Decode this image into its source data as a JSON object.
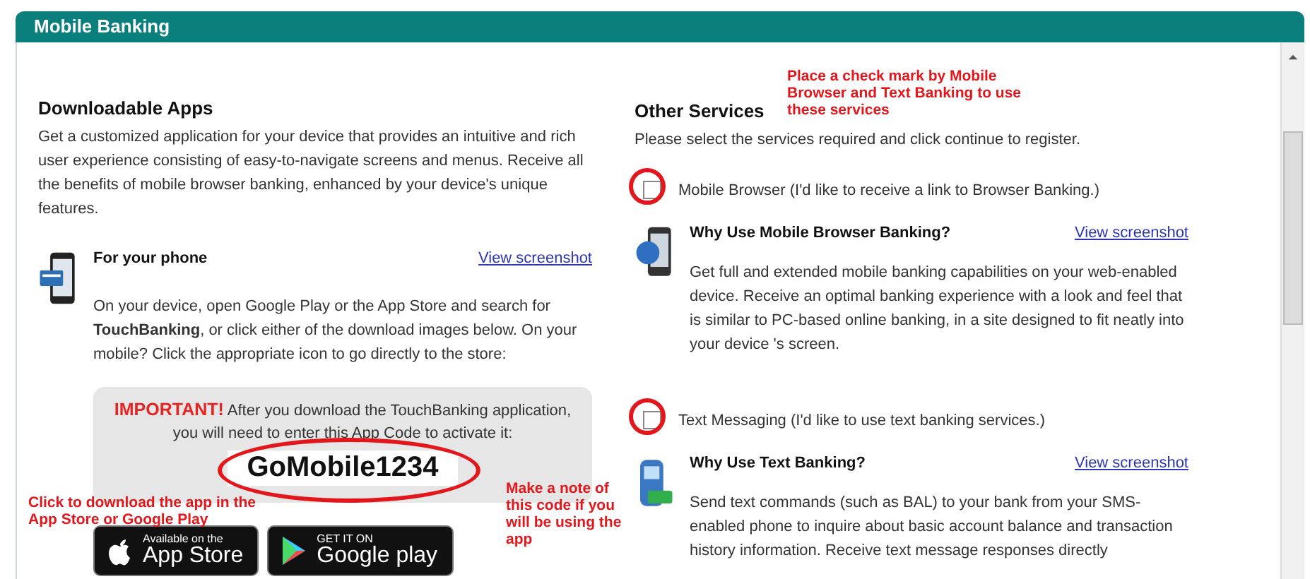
{
  "panel": {
    "title": "Mobile Banking"
  },
  "downloadable_apps": {
    "heading": "Downloadable Apps",
    "description": "Get a customized application for your device that provides an intuitive and rich user experience consisting of easy-to-navigate screens and menus. Receive all the benefits of mobile browser banking, enhanced by your device's unique features.",
    "phone": {
      "title": "For your phone",
      "link": "View screenshot",
      "instructions": "On your device, open Google Play or the App Store and search for **TouchBanking**, or click either of the download images below. On your mobile? Click the appropriate icon to go directly to the store:"
    },
    "important": {
      "label": "IMPORTANT!",
      "text": "After you download the TouchBanking application, you will need to enter this App Code to activate it:",
      "code": "GoMobile1234"
    },
    "store_buttons": [
      {
        "kind": "apple",
        "small": "Available on the",
        "big": "App Store"
      },
      {
        "kind": "google",
        "small": "GET IT ON",
        "big": "Google play"
      }
    ]
  },
  "other_services": {
    "heading": "Other Services",
    "description": "Please select the services required and click continue to register.",
    "services": [
      {
        "kind": "browser",
        "label": "Mobile Browser (I'd like to receive a link to Browser Banking.)",
        "checked": false,
        "title": "Why Use Mobile Browser Banking?",
        "link": "View screenshot",
        "description": "Get full and extended mobile banking capabilities on your web-enabled device. Receive an optimal banking experience with a look and feel that is similar to PC-based online banking, in a site designed to fit neatly into your device 's screen."
      },
      {
        "kind": "sms",
        "label": "Text Messaging (I'd like to use text banking services.)",
        "checked": false,
        "title": "Why Use Text Banking?",
        "link": "View screenshot",
        "description": "Send text commands (such as BAL) to your bank from your SMS-enabled phone to inquire about basic account balance and transaction history information. Receive text message responses directly"
      }
    ]
  },
  "annotations": [
    {
      "kind": "services",
      "text": "Place a check mark by Mobile Browser and Text Banking to use these services"
    },
    {
      "kind": "download",
      "text": "Click to download the app in the App Store or Google Play"
    },
    {
      "kind": "code",
      "text": "Make a note of this code if you will be using the app"
    }
  ]
}
